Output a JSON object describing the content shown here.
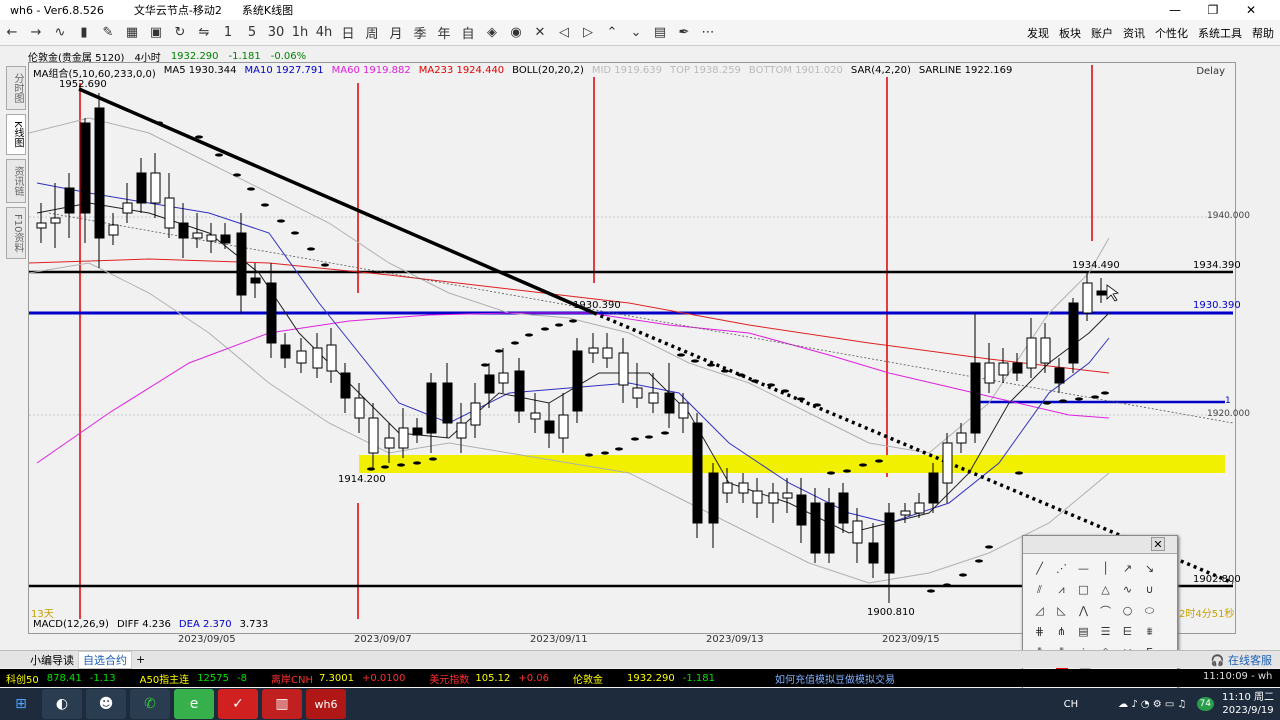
{
  "window": {
    "title": "wh6 - Ver6.8.526",
    "server": "文华云节点-移动2",
    "view": "系统K线图",
    "buttons": [
      "—",
      "❐",
      "✕"
    ]
  },
  "toolbar": {
    "periods": [
      "1",
      "5",
      "30",
      "1h",
      "4h",
      "日",
      "周",
      "月",
      "季",
      "年",
      "自"
    ],
    "menu": [
      "发现",
      "板块",
      "账户",
      "资讯",
      "个性化",
      "系统工具",
      "帮助"
    ]
  },
  "sidebar": {
    "tabs": [
      "分时图",
      "K线图",
      "资讯链",
      "F10资料"
    ],
    "active": 1
  },
  "infobar": {
    "name": "伦敦金(贵金属 5120)",
    "period": "4小时",
    "price": "1932.290",
    "change": "-1.181",
    "pct": "-0.06%"
  },
  "legend": {
    "ma_group": "MA组合(5,10,60,233,0,0)",
    "ma5": "MA5 1930.344",
    "ma10": "MA10 1927.791",
    "ma60": "MA60 1919.882",
    "ma233": "MA233 1924.440",
    "boll": "BOLL(20,20,2)",
    "mid": "MID 1919.639",
    "top": "TOP 1938.259",
    "bottom": "BOTTOM 1901.020",
    "sar": "SAR(4,2,20)",
    "sarline": "SARLINE 1922.169",
    "delay": "Delay"
  },
  "annotations": {
    "high": "1952.690",
    "low1": "1914.200",
    "mid": "1930.390",
    "low2": "1900.810",
    "recent_high": "1934.490",
    "level1": "1934.390",
    "level2": "1930.390",
    "level3": "1902.800",
    "axis1": "1940.000",
    "axis2": "1920.000",
    "count": "13天",
    "countdown": "2时4分51秒",
    "level_mark": "1"
  },
  "macd": {
    "label": "MACD(12,26,9)",
    "diff": "DIFF 4.236",
    "dea": "DEA 2.370",
    "macd": "3.733"
  },
  "dates": [
    "2023/09/05",
    "2023/09/07",
    "2023/09/11",
    "2023/09/13",
    "2023/09/15"
  ],
  "tabs": {
    "guide": "小编导读",
    "custom": "自选合约",
    "add": "+",
    "online": "在线客服"
  },
  "ticker": [
    {
      "name": "科创50",
      "value": "878.41",
      "chg": "-1.13"
    },
    {
      "name": "A50指主连",
      "value": "12575",
      "chg": "-8"
    },
    {
      "name": "离岸CNH",
      "value": "7.3001",
      "chg": "+0.0100"
    },
    {
      "name": "美元指数",
      "value": "105.12",
      "chg": "+0.06"
    },
    {
      "name": "伦敦金",
      "value": "1932.290",
      "chg": "-1.181"
    }
  ],
  "ticker_msg": "如何充值模拟豆做模拟交易",
  "tray": {
    "ime": "CH",
    "time": "11:10",
    "weekday": "周二",
    "date": "2023/9/19",
    "status": "11:10:09 - wh",
    "badge": "74"
  },
  "colors": {
    "up": "#ffffff",
    "down": "#000000",
    "red_line": "#e00000",
    "blue_line": "#0000c8",
    "yellow_band": "#f0f000",
    "ma_pink": "#e020e0"
  }
}
